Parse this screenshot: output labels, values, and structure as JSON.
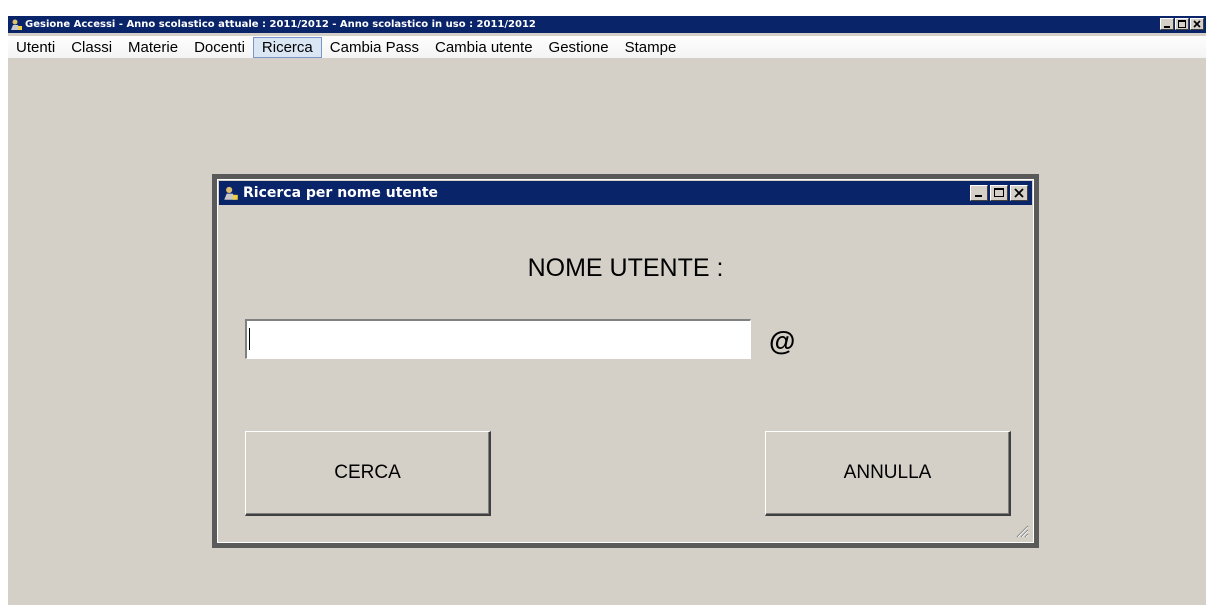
{
  "app": {
    "title": "Gesione Accessi - Anno scolastico attuale : 2011/2012 - Anno scolastico in uso : 2011/2012",
    "icon": "app-icon"
  },
  "menu": {
    "items": [
      {
        "label": "Utenti"
      },
      {
        "label": "Classi"
      },
      {
        "label": "Materie"
      },
      {
        "label": "Docenti"
      },
      {
        "label": "Ricerca",
        "active": true
      },
      {
        "label": "Cambia Pass"
      },
      {
        "label": "Cambia utente"
      },
      {
        "label": "Gestione"
      },
      {
        "label": "Stampe"
      }
    ]
  },
  "dialog": {
    "title": "Ricerca per nome utente",
    "heading": "NOME UTENTE :",
    "input_value": "",
    "at_symbol": "@",
    "search_button": "CERCA",
    "cancel_button": "ANNULLA"
  },
  "colors": {
    "titlebar": "#0a246a",
    "face": "#d4d0c8",
    "menu_active": "#dbe6f4"
  }
}
